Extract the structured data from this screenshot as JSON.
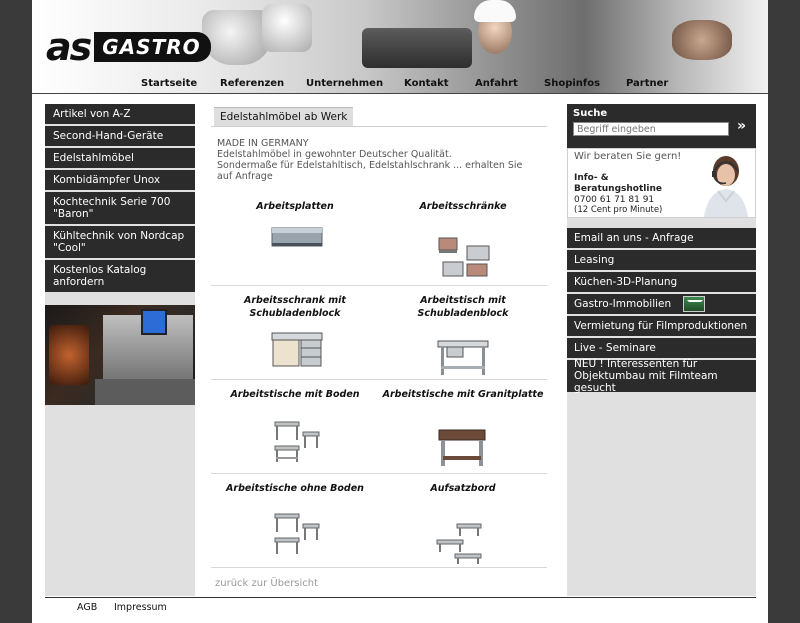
{
  "brand": {
    "logo_as": "as",
    "logo_gastro": "GASTRO"
  },
  "nav": {
    "items": [
      "Startseite",
      "Referenzen",
      "Unternehmen",
      "Kontakt",
      "Anfahrt",
      "Shopinfos",
      "Partner"
    ]
  },
  "left_nav": {
    "items": [
      "Artikel von A-Z",
      "Second-Hand-Geräte",
      "Edelstahlmöbel",
      "Kombidämpfer Unox",
      "Kochtechnik Serie 700 \"Baron\"",
      "Kühltechnik von Nordcap \"Cool\"",
      "Kostenlos Katalog anfordern"
    ]
  },
  "main": {
    "section_title": "Edelstahlmöbel ab Werk",
    "intro_line1": "MADE IN GERMANY",
    "intro_line2": "Edelstahlmöbel in gewohnter Deutscher Qualität.",
    "intro_line3": "Sondermaße für Edelstahltisch, Edelstahlschrank ... erhalten Sie auf Anfrage",
    "products": [
      "Arbeitsplatten",
      "Arbeitsschränke",
      "Arbeitsschrank mit Schubladenblock",
      "Arbeitstisch mit Schubladenblock",
      "Arbeitstische mit Boden",
      "Arbeitstische mit Granitplatte",
      "Arbeitstische ohne Boden",
      "Aufsatzbord"
    ],
    "back_link": "zurück zur Übersicht"
  },
  "search": {
    "label": "Suche",
    "placeholder": "Begriff eingeben",
    "go": "»"
  },
  "hotline": {
    "slogan": "Wir beraten Sie gern!",
    "title": "Info- & Beratungshotline",
    "phone": "0700 61 71 81 91",
    "note": "(12 Cent pro Minute)"
  },
  "right_nav": {
    "items": [
      "Email an uns - Anfrage",
      "Leasing",
      "Küchen-3D-Planung",
      "Gastro-Immobilien",
      "Vermietung für Filmproduktionen",
      "Live - Seminare",
      "NEU ! Interessenten für Objektumbau mit Filmteam gesucht"
    ]
  },
  "footer": {
    "links": [
      "AGB",
      "Impressum"
    ]
  },
  "colors": {
    "nav_bg": "#2b2b2b",
    "sidebar_bg": "#e0e0e0",
    "page_bg": "#3a3a3a"
  }
}
